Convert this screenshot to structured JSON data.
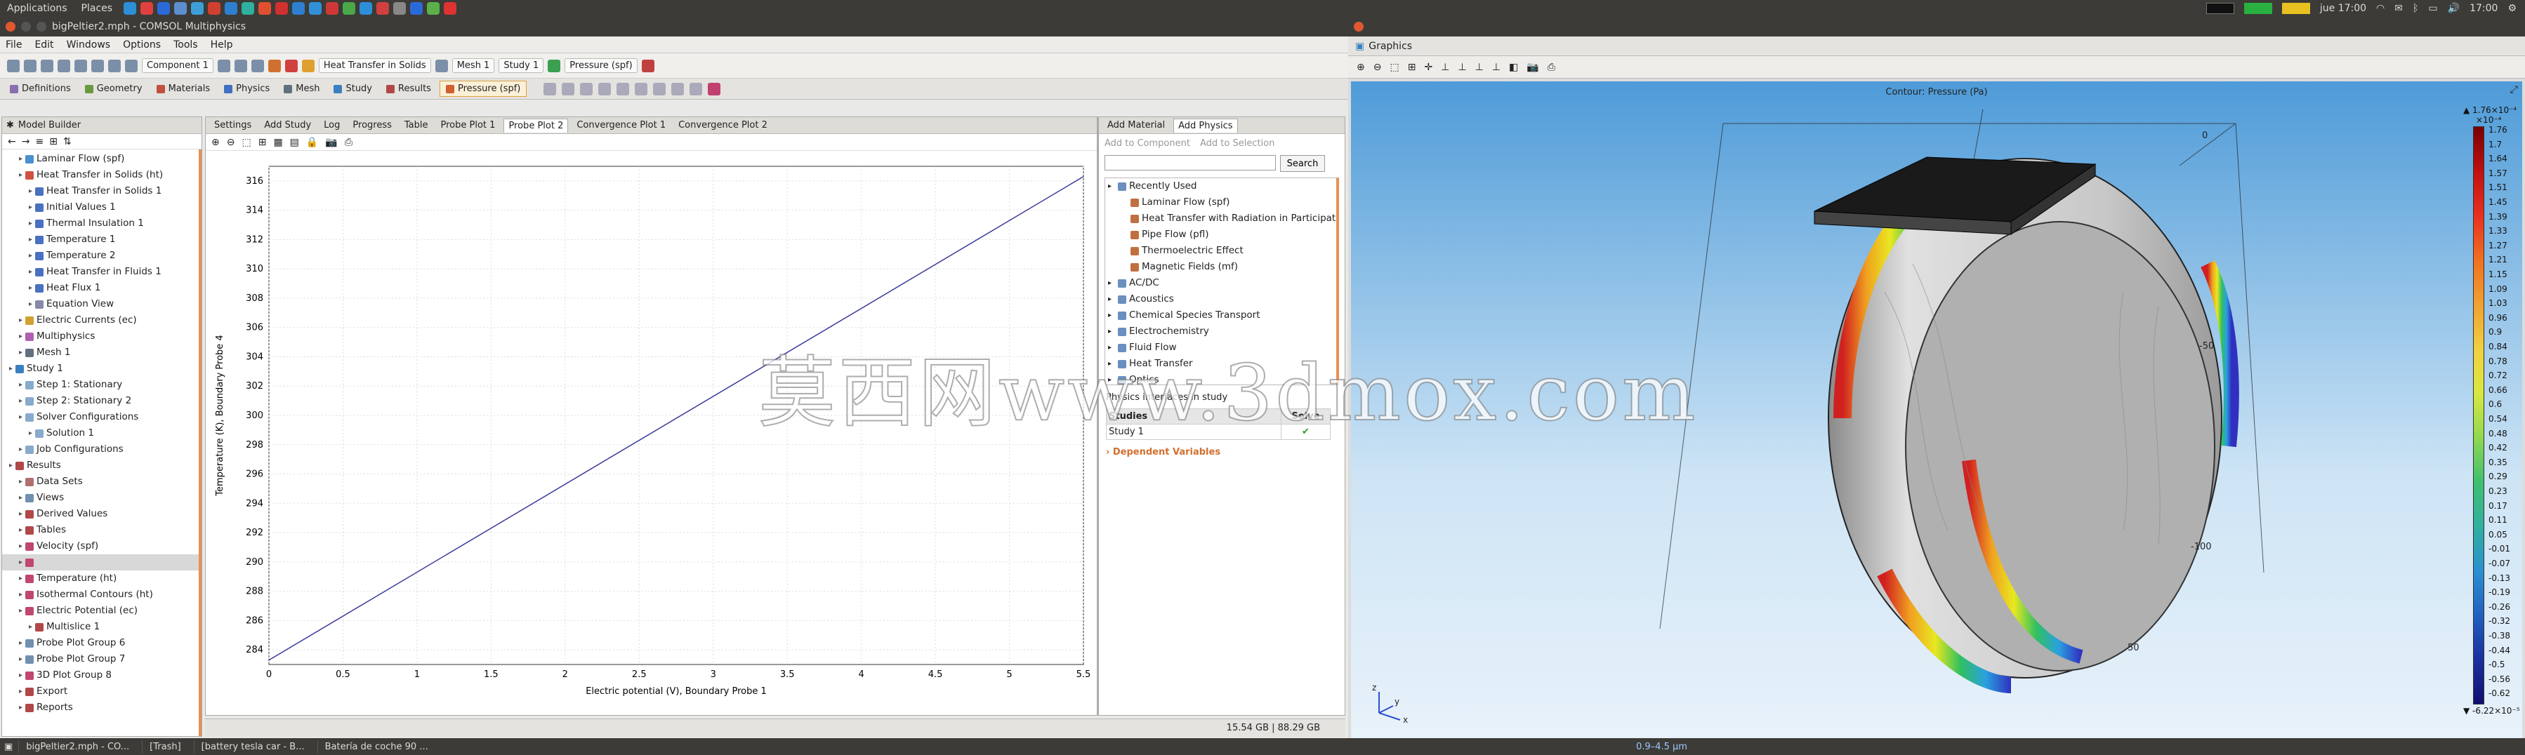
{
  "sysbar": {
    "applications": "Applications",
    "places": "Places",
    "window_title": "bigPeltier2.mph - COMSOL Multiphysics",
    "clock_left": "jue 17:00",
    "clock_right": "17:00",
    "tray_colors": [
      "#2d8fd8",
      "#e04040",
      "#2a6ad8",
      "#5c8fd0",
      "#3e9fd8",
      "#d04030",
      "#2e7fd0",
      "#2fb0a0",
      "#e05030",
      "#d03030",
      "#2e7fd0",
      "#3090d8",
      "#d03838",
      "#4aa848",
      "#2e8ed8",
      "#d04040",
      "#888888",
      "#2a6ad8",
      "#5bb04a",
      "#dd3333"
    ]
  },
  "menu": [
    "File",
    "Edit",
    "Windows",
    "Options",
    "Tools",
    "Help"
  ],
  "toolbar1": {
    "component": "Component 1",
    "physics": "Heat Transfer in Solids",
    "mesh": "Mesh 1",
    "study": "Study 1",
    "plot": "Pressure (spf)"
  },
  "ribbon": [
    {
      "label": "Definitions",
      "color": "#8a6fb0"
    },
    {
      "label": "Geometry",
      "color": "#6a9a40"
    },
    {
      "label": "Materials",
      "color": "#c05040"
    },
    {
      "label": "Physics",
      "color": "#4070c0"
    },
    {
      "label": "Mesh",
      "color": "#607080"
    },
    {
      "label": "Study",
      "color": "#3a80c0"
    },
    {
      "label": "Results",
      "color": "#b04848"
    },
    {
      "label": "Pressure (spf)",
      "color": "#d06030",
      "active": true
    }
  ],
  "model_builder": {
    "title": "Model Builder",
    "items": [
      {
        "label": "Laminar Flow (spf)",
        "indent": 1,
        "color": "#4a90d0"
      },
      {
        "label": "Heat Transfer in Solids (ht)",
        "indent": 1,
        "color": "#d05040"
      },
      {
        "label": "Heat Transfer in Solids 1",
        "indent": 2,
        "color": "#4a70c0"
      },
      {
        "label": "Initial Values 1",
        "indent": 2,
        "color": "#4a70c0"
      },
      {
        "label": "Thermal Insulation 1",
        "indent": 2,
        "color": "#4a70c0"
      },
      {
        "label": "Temperature 1",
        "indent": 2,
        "color": "#4a70c0"
      },
      {
        "label": "Temperature 2",
        "indent": 2,
        "color": "#4a70c0"
      },
      {
        "label": "Heat Transfer in Fluids 1",
        "indent": 2,
        "color": "#4a70c0"
      },
      {
        "label": "Heat Flux 1",
        "indent": 2,
        "color": "#4a70c0"
      },
      {
        "label": "Equation View",
        "indent": 2,
        "color": "#8888aa"
      },
      {
        "label": "Electric Currents (ec)",
        "indent": 1,
        "color": "#d0a030"
      },
      {
        "label": "Multiphysics",
        "indent": 1,
        "color": "#b060b0"
      },
      {
        "label": "Mesh 1",
        "indent": 1,
        "color": "#607080"
      },
      {
        "label": "Study 1",
        "indent": 0,
        "color": "#3a80c0"
      },
      {
        "label": "Step 1: Stationary",
        "indent": 1,
        "color": "#88aacc"
      },
      {
        "label": "Step 2: Stationary 2",
        "indent": 1,
        "color": "#88aacc"
      },
      {
        "label": "Solver Configurations",
        "indent": 1,
        "color": "#88aacc"
      },
      {
        "label": "Solution 1",
        "indent": 2,
        "color": "#88aacc"
      },
      {
        "label": "Job Configurations",
        "indent": 1,
        "color": "#88aacc"
      },
      {
        "label": "Results",
        "indent": 0,
        "color": "#b04848"
      },
      {
        "label": "Data Sets",
        "indent": 1,
        "color": "#b07070"
      },
      {
        "label": "Views",
        "indent": 1,
        "color": "#7090b0"
      },
      {
        "label": "Derived Values",
        "indent": 1,
        "color": "#b04848"
      },
      {
        "label": "Tables",
        "indent": 1,
        "color": "#b04848"
      },
      {
        "label": "Velocity (spf)",
        "indent": 1,
        "color": "#c04870"
      },
      {
        "label": "",
        "indent": 1,
        "color": "#c04870",
        "selected": true
      },
      {
        "label": "Temperature (ht)",
        "indent": 1,
        "color": "#c04870"
      },
      {
        "label": "Isothermal Contours (ht)",
        "indent": 1,
        "color": "#c04870"
      },
      {
        "label": "Electric Potential (ec)",
        "indent": 1,
        "color": "#c04870"
      },
      {
        "label": "Multislice 1",
        "indent": 2,
        "color": "#b04848"
      },
      {
        "label": "Probe Plot Group 6",
        "indent": 1,
        "color": "#7090b0"
      },
      {
        "label": "Probe Plot Group 7",
        "indent": 1,
        "color": "#7090b0"
      },
      {
        "label": "3D Plot Group 8",
        "indent": 1,
        "color": "#c04870"
      },
      {
        "label": "Export",
        "indent": 1,
        "color": "#b04848"
      },
      {
        "label": "Reports",
        "indent": 1,
        "color": "#b04848"
      }
    ]
  },
  "center_tabs": [
    "Settings",
    "Add Study",
    "Log",
    "Progress",
    "Table",
    "Probe Plot 1",
    "Probe Plot 2",
    "Convergence Plot 1",
    "Convergence Plot 2"
  ],
  "chart_data": {
    "type": "line",
    "title": "",
    "xlabel": "Electric potential (V), Boundary Probe 1",
    "ylabel": "Temperature (K), Boundary Probe 4",
    "xlim": [
      0,
      5.5
    ],
    "ylim": [
      283,
      317
    ],
    "xticks": [
      "0",
      "0.5",
      "1",
      "1.5",
      "2",
      "2.5",
      "3",
      "3.5",
      "4",
      "4.5",
      "5",
      "5.5"
    ],
    "yticks": [
      "284",
      "286",
      "288",
      "290",
      "292",
      "294",
      "296",
      "298",
      "300",
      "302",
      "304",
      "306",
      "308",
      "310",
      "312",
      "314",
      "316"
    ],
    "series": [
      {
        "x": [
          0,
          5.5
        ],
        "y": [
          283.3,
          316.3
        ],
        "color": "#3a3a9a"
      }
    ],
    "grid": true
  },
  "status": {
    "memory": "15.54 GB | 88.29 GB"
  },
  "add_physics": {
    "tabs": [
      "Add Material",
      "Add Physics"
    ],
    "add_component": "Add to Component",
    "add_selection": "Add to Selection",
    "search_button": "Search",
    "search_value": "",
    "tree": [
      {
        "label": "Recently Used",
        "indent": 0
      },
      {
        "label": "Laminar Flow (spf)",
        "indent": 1
      },
      {
        "label": "Heat Transfer with Radiation in Participat",
        "indent": 1
      },
      {
        "label": "Pipe Flow (pfl)",
        "indent": 1
      },
      {
        "label": "Thermoelectric Effect",
        "indent": 1
      },
      {
        "label": "Magnetic Fields (mf)",
        "indent": 1
      },
      {
        "label": "AC/DC",
        "indent": 0
      },
      {
        "label": "Acoustics",
        "indent": 0
      },
      {
        "label": "Chemical Species Transport",
        "indent": 0
      },
      {
        "label": "Electrochemistry",
        "indent": 0
      },
      {
        "label": "Fluid Flow",
        "indent": 0
      },
      {
        "label": "Heat Transfer",
        "indent": 0
      },
      {
        "label": "Optics",
        "indent": 0
      }
    ],
    "interfaces_label": "Physics interfaces in study",
    "studies_header": "Studies",
    "solve_header": "Solve",
    "study_row": "Study 1",
    "dependent_vars": "Dependent Variables"
  },
  "graphics": {
    "title": "Graphics",
    "plot_title": "Contour: Pressure (Pa)",
    "cb_max": "▲ 1.76×10⁻⁴",
    "cb_exp": "×10⁻⁴",
    "cb_min": "▼ -6.22×10⁻⁵",
    "cb_values": [
      "1.76",
      "1.7",
      "1.64",
      "1.57",
      "1.51",
      "1.45",
      "1.39",
      "1.33",
      "1.27",
      "1.21",
      "1.15",
      "1.09",
      "1.03",
      "0.96",
      "0.9",
      "0.84",
      "0.78",
      "0.72",
      "0.66",
      "0.6",
      "0.54",
      "0.48",
      "0.42",
      "0.35",
      "0.29",
      "0.23",
      "0.17",
      "0.11",
      "0.05",
      "-0.01",
      "-0.07",
      "-0.13",
      "-0.19",
      "-0.26",
      "-0.32",
      "-0.38",
      "-0.44",
      "-0.5",
      "-0.56",
      "-0.62"
    ],
    "axis_labels": [
      "0",
      "-50",
      "-100",
      "50"
    ],
    "bottom_caption": "0.9–4.5 μm"
  },
  "taskbar": [
    "bigPeltier2.mph - CO...",
    "[Trash]",
    "[battery tesla car - B...",
    "Batería de coche 90 ..."
  ],
  "watermark": "莫西网www.3dmox.com"
}
